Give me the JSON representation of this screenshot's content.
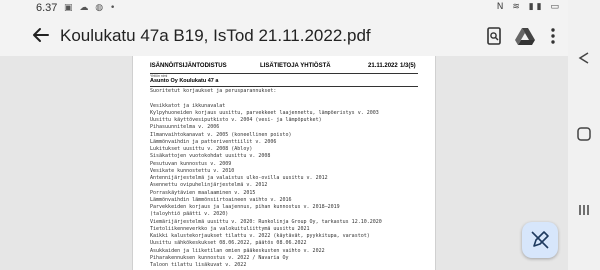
{
  "status_bar": {
    "time": "6.37",
    "left_icons": "▣ ☁ ◍ •",
    "right_icons": "N ≋ ▮▮ ▭"
  },
  "app_bar": {
    "title": "Koulukatu 47a B19, IsTod 21.11.2022.pdf",
    "back_icon": "arrow-back",
    "actions": [
      "document-search",
      "google-drive",
      "more-vert"
    ]
  },
  "document": {
    "header": {
      "left": "ISÄNNÖITSIJÄNTODISTUS",
      "center": "LISÄTIETOJA YHTIÖSTÄ",
      "date": "21.11.2022",
      "page": "1/3(5)"
    },
    "company_label": "Yhtiön nimi",
    "company": "Asunto Oy Koulukatu 47 a",
    "lines": [
      "Suoritetut korjaukset ja perusparannukset:",
      "",
      "Vesikkatot ja ikkunavalat",
      "Kylpyhuoneiden korjaus uusittu, parvekkeet laajennettu, lämpöeristys v. 2003",
      "Uusittu käyttövesiputkisto v. 2004 (vesi- ja lämpöputket)",
      "Pihasuunnitelma v. 2006",
      "Ilmanvaihtokanavat v. 2005 (koneellinen poisto)",
      "Lämmönvaihdin ja patteriventtiilit v. 2006",
      "Lukitukset uusittu v. 2008 (Abloy)",
      "Sisäkattojen vuotokohdat uusittu v. 2008",
      "Pesutuvan kunnostus v. 2009",
      "Vesikate kunnostettu v. 2010",
      "Antennijärjestelmä ja valaistus ulko-ovilla uusittu v. 2012",
      "Asennettu ovipuhelinjärjestelmä v. 2012",
      "Porraskäytävien maalaaminen v. 2015",
      "Lämmönvaihdin lämmönsiirtoaineen vaihto v. 2016",
      "Parvekkeiden korjaus ja laajennus, pihan kunnostus v. 2018–2019",
      "(taloyhtiö päätti v. 2020)",
      "Viemärijärjestelmä uusittu v. 2020: Runkolinja Group Oy, tarkastus 12.10.2020",
      "Tietoliikenneverkko ja valokuituliittymä uusittu 2021",
      "Kaikki kalustekorjaukset tilattu v. 2022 (käytävät, pyykkitupa, varastot)",
      "Uusittu sähkökeskukset 08.06.2022, päätös 08.06.2022",
      "Asukkaiden ja liiketilan omien pääkeskusten vaihto v. 2022",
      "Piharakennuksen kunnostus v. 2022 / Navaria Oy",
      "Taloon tilattu lisäkuvat v. 2022"
    ]
  },
  "side_nav": [
    "back",
    "home",
    "recents"
  ],
  "fab_icon": "edit-off"
}
